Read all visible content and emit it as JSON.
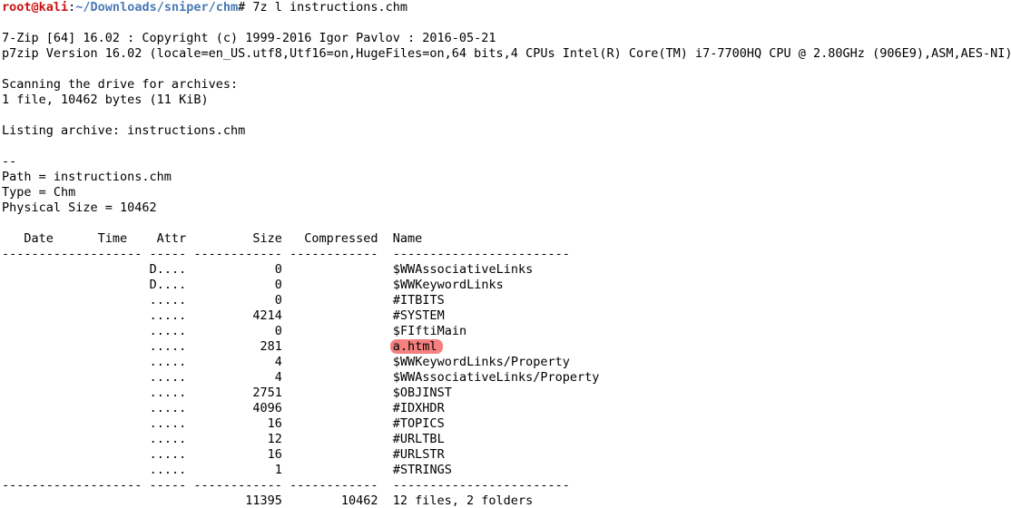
{
  "prompt": {
    "user": "root@kali",
    "colon": ":",
    "path": "~/Downloads/sniper/chm",
    "symbol": "#",
    "command": " 7z l instructions.chm"
  },
  "header_lines": [
    "",
    "7-Zip [64] 16.02 : Copyright (c) 1999-2016 Igor Pavlov : 2016-05-21",
    "p7zip Version 16.02 (locale=en_US.utf8,Utf16=on,HugeFiles=on,64 bits,4 CPUs Intel(R) Core(TM) i7-7700HQ CPU @ 2.80GHz (906E9),ASM,AES-NI)",
    "",
    "Scanning the drive for archives:",
    "1 file, 10462 bytes (11 KiB)",
    "",
    "Listing archive: instructions.chm",
    "",
    "--",
    "Path = instructions.chm",
    "Type = Chm",
    "Physical Size = 10462",
    ""
  ],
  "table": {
    "header": "   Date      Time    Attr         Size   Compressed  Name",
    "separator": "------------------- ----- ------------ ------------  ------------------------",
    "row_indent": "                    ",
    "rows": [
      {
        "attr": "D....",
        "size": "0",
        "name": "$WWAssociativeLinks",
        "highlight": false
      },
      {
        "attr": "D....",
        "size": "0",
        "name": "$WWKeywordLinks",
        "highlight": false
      },
      {
        "attr": ".....",
        "size": "0",
        "name": "#ITBITS",
        "highlight": false
      },
      {
        "attr": ".....",
        "size": "4214",
        "name": "#SYSTEM",
        "highlight": false
      },
      {
        "attr": ".....",
        "size": "0",
        "name": "$FIftiMain",
        "highlight": false
      },
      {
        "attr": ".....",
        "size": "281",
        "name": "a.html",
        "highlight": true
      },
      {
        "attr": ".....",
        "size": "4",
        "name": "$WWKeywordLinks/Property",
        "highlight": false
      },
      {
        "attr": ".....",
        "size": "4",
        "name": "$WWAssociativeLinks/Property",
        "highlight": false
      },
      {
        "attr": ".....",
        "size": "2751",
        "name": "$OBJINST",
        "highlight": false
      },
      {
        "attr": ".....",
        "size": "4096",
        "name": "#IDXHDR",
        "highlight": false
      },
      {
        "attr": ".....",
        "size": "16",
        "name": "#TOPICS",
        "highlight": false
      },
      {
        "attr": ".....",
        "size": "12",
        "name": "#URLTBL",
        "highlight": false
      },
      {
        "attr": ".....",
        "size": "16",
        "name": "#URLSTR",
        "highlight": false
      },
      {
        "attr": ".....",
        "size": "1",
        "name": "#STRINGS",
        "highlight": false
      }
    ],
    "footer_separator": "------------------- ----- ------------ ------------  ------------------------",
    "summary": "                                 11395        10462  12 files, 2 folders"
  },
  "colors": {
    "background": "#ffffff",
    "text": "#000000",
    "prompt_user": "#cc1111",
    "prompt_path": "#4a7ab5",
    "highlight": "#f48080"
  }
}
